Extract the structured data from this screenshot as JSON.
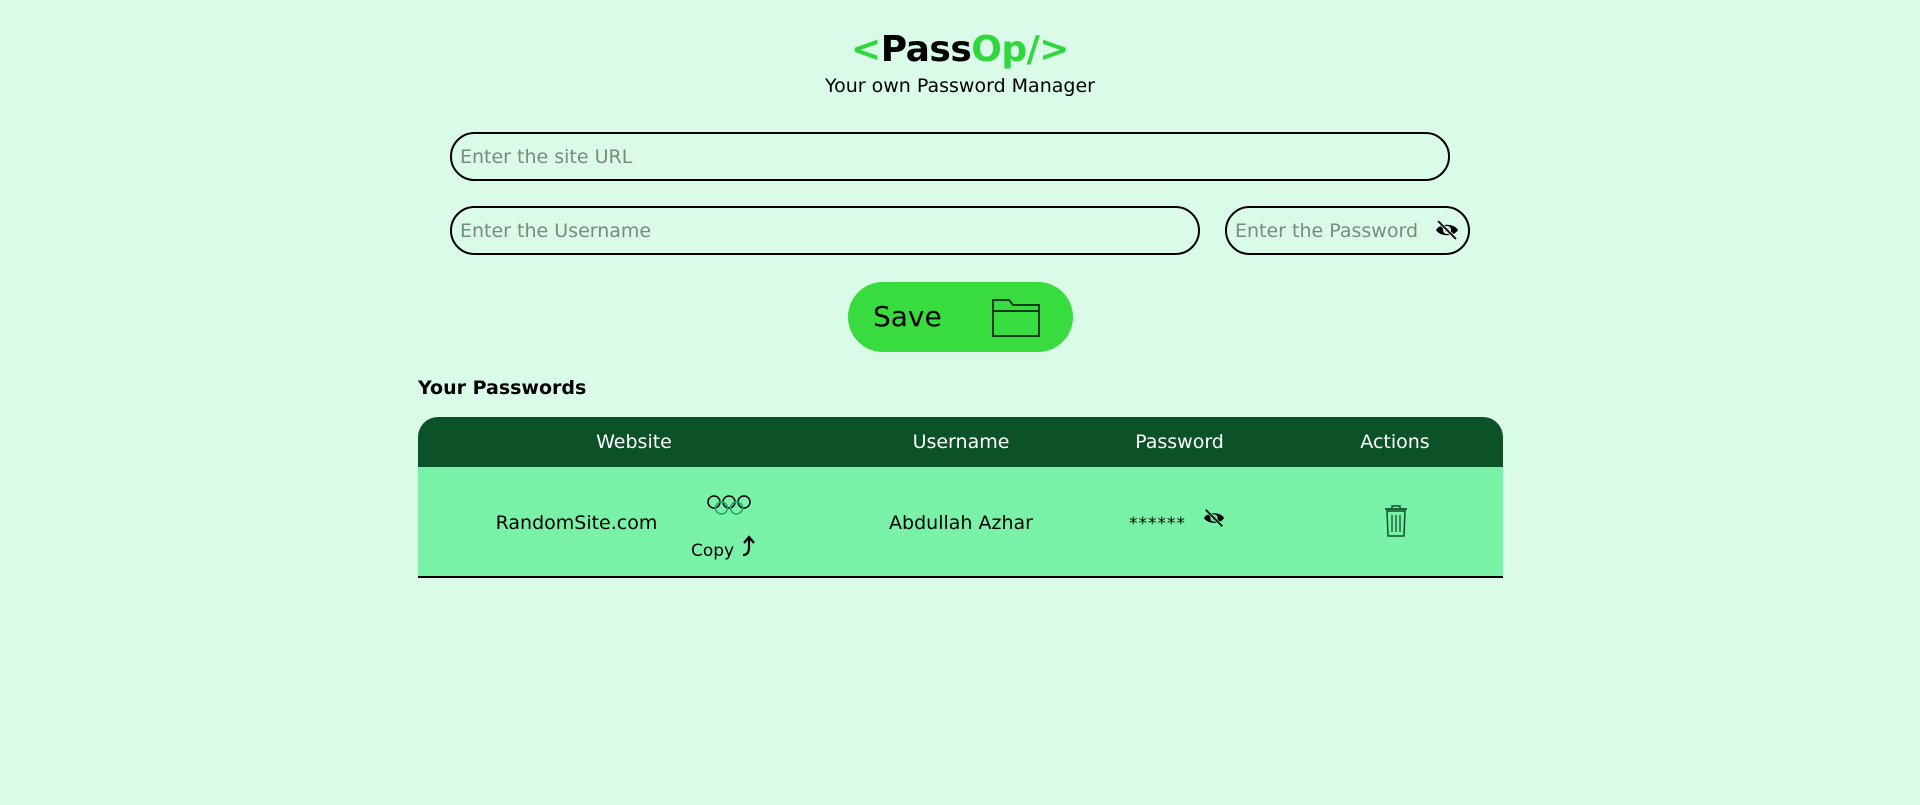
{
  "brand": {
    "open": "<",
    "pass": "Pass",
    "op": "Op/",
    "close": ">",
    "tagline": "Your own Password Manager"
  },
  "form": {
    "url_placeholder": "Enter the site URL",
    "url_value": "",
    "username_placeholder": "Enter the Username",
    "username_value": "",
    "password_placeholder": "Enter the Password",
    "password_value": "",
    "password_toggle_icon": "eye-off-icon",
    "save_label": "Save",
    "save_icon": "folder-icon"
  },
  "passwords": {
    "title": "Your Passwords",
    "columns": [
      "Website",
      "Username",
      "Password",
      "Actions"
    ],
    "rows": [
      {
        "website": "RandomSite.com",
        "copy_label": "Copy",
        "copy_icon": "copy-icon",
        "username": "Abdullah Azhar",
        "password": "******",
        "reveal_icon": "eye-off-icon",
        "delete_icon": "trash-icon"
      }
    ]
  },
  "colors": {
    "background": "#dafbe8",
    "accent": "#38dc3f",
    "header": "#0c5228",
    "row": "#79f2a7"
  }
}
